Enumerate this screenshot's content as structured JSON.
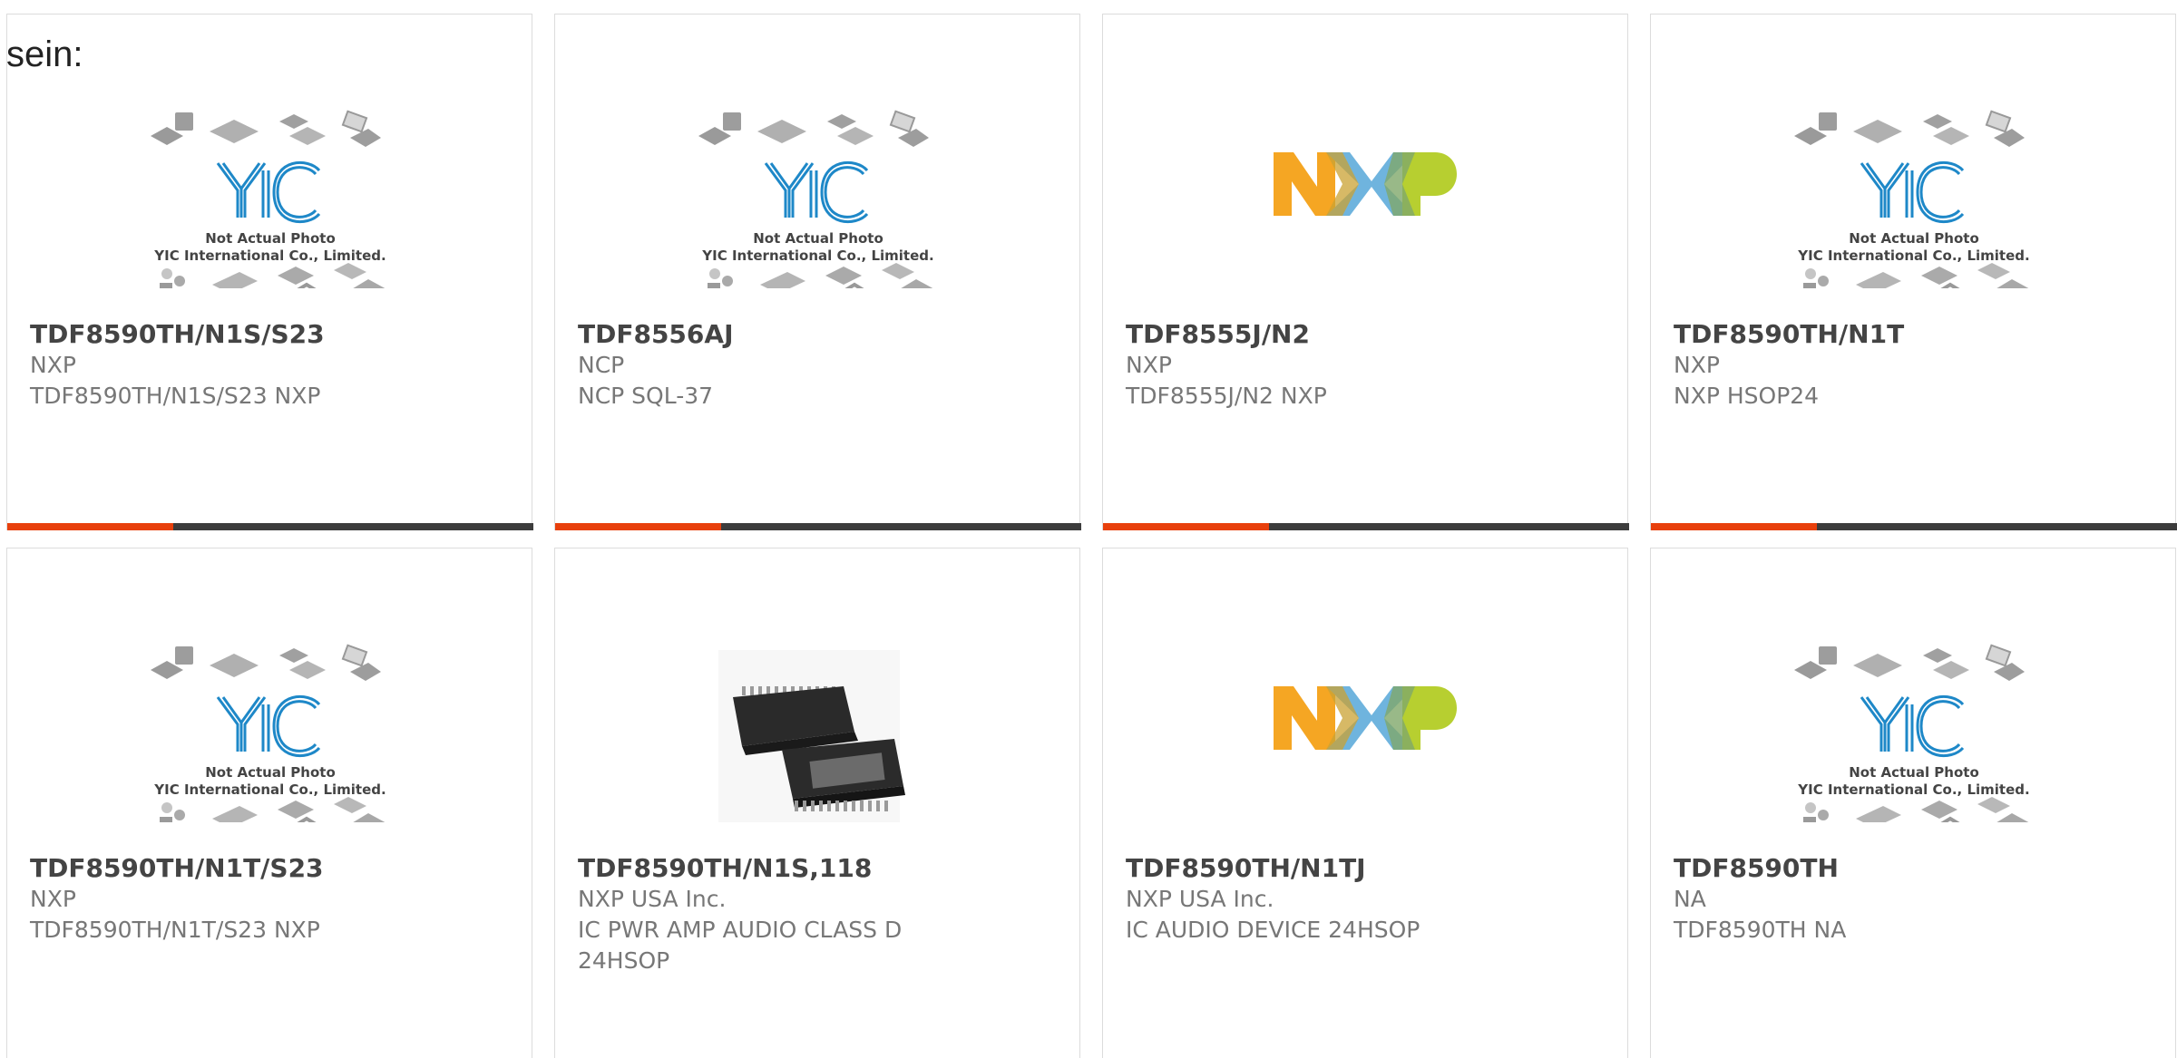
{
  "lead_text": "sein:",
  "colors": {
    "accent_bar": "#e8400c",
    "dark_bar": "#3c3c3c",
    "yic_blue": "#1e88c8",
    "nxp_orange": "#f5a623",
    "nxp_blue": "#6fb4de",
    "nxp_green": "#b7cf30"
  },
  "placeholder_image": {
    "line1": "Not Actual Photo",
    "line2": "YIC International Co., Limited."
  },
  "products": [
    {
      "part": "TDF8590TH/N1S/S23",
      "manufacturer": "NXP",
      "description": "TDF8590TH/N1S/S23 NXP",
      "image": "yic-placeholder"
    },
    {
      "part": "TDF8556AJ",
      "manufacturer": "NCP",
      "description": "NCP SQL-37",
      "image": "yic-placeholder"
    },
    {
      "part": "TDF8555J/N2",
      "manufacturer": "NXP",
      "description": "TDF8555J/N2 NXP",
      "image": "nxp-logo"
    },
    {
      "part": "TDF8590TH/N1T",
      "manufacturer": "NXP",
      "description": "NXP HSOP24",
      "image": "yic-placeholder"
    },
    {
      "part": "TDF8590TH/N1T/S23",
      "manufacturer": "NXP",
      "description": "TDF8590TH/N1T/S23 NXP",
      "image": "yic-placeholder"
    },
    {
      "part": "TDF8590TH/N1S,118",
      "manufacturer": "NXP USA Inc.",
      "description": "IC PWR AMP AUDIO CLASS D 24HSOP",
      "image": "chip-photo"
    },
    {
      "part": "TDF8590TH/N1TJ",
      "manufacturer": "NXP USA Inc.",
      "description": "IC AUDIO DEVICE 24HSOP",
      "image": "nxp-logo"
    },
    {
      "part": "TDF8590TH",
      "manufacturer": "NA",
      "description": "TDF8590TH NA",
      "image": "yic-placeholder"
    }
  ]
}
